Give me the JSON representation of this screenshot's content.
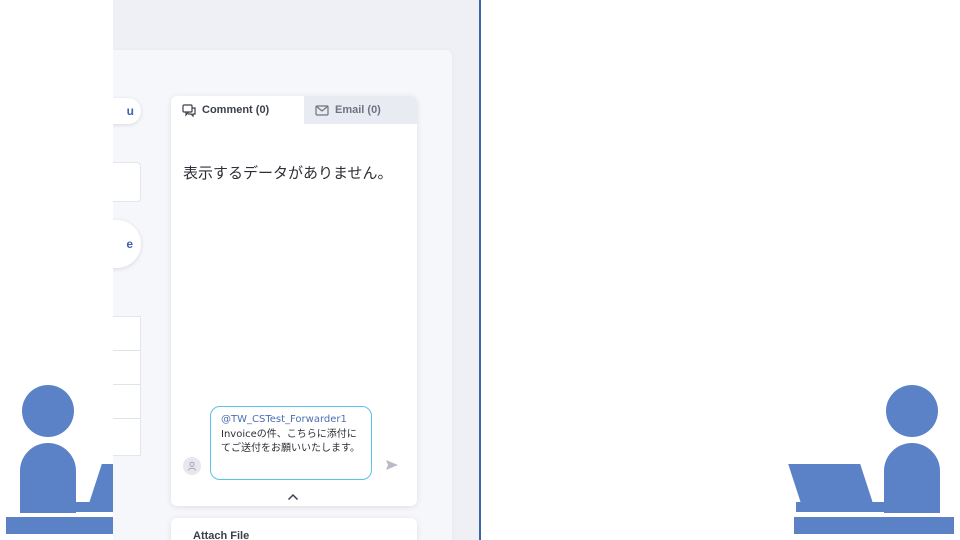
{
  "left_panel": {
    "pill_label": "u",
    "circle_button_label": "e"
  },
  "comment_panel": {
    "tabs": [
      {
        "label": "Comment (0)",
        "icon": "comment-icon",
        "active": true
      },
      {
        "label": "Email (0)",
        "icon": "mail-icon",
        "active": false
      }
    ],
    "empty_message": "表示するデータがありません。",
    "composer": {
      "mention": "@TW_CSTest_Forwarder1",
      "text": "Invoiceの件、こちらに添付にてご送付をお願いいたします。"
    },
    "send_icon": "send-icon",
    "collapse_icon": "chevron-up-icon"
  },
  "attach_panel": {
    "title": "Attach File"
  },
  "colors": {
    "accent": "#3e64ac",
    "illustration": "#5b82c6",
    "composer_border": "#5cc1ea"
  }
}
